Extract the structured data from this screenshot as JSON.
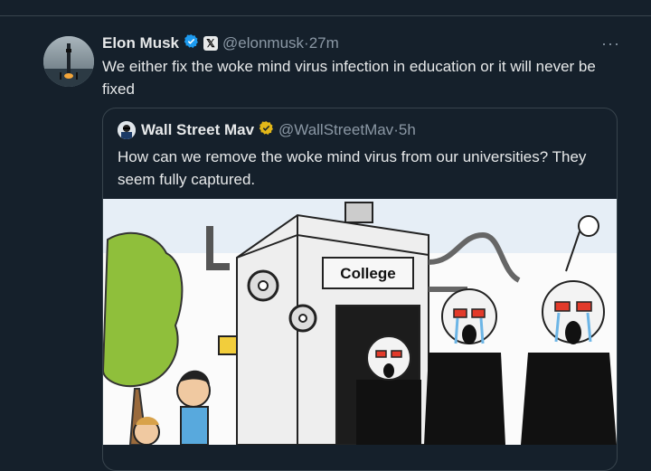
{
  "tweet": {
    "author_name": "Elon Musk",
    "handle": "@elonmusk",
    "separator": "·",
    "time": "27m",
    "text": "We either fix the woke mind virus infection in education or it will never be fixed",
    "more_label": "···",
    "x_badge": "𝕏"
  },
  "quoted": {
    "author_name": "Wall Street Mav",
    "handle": "@WallStreetMav",
    "separator": "·",
    "time": "5h",
    "text": "How can we remove the woke mind virus from our universities? They seem fully captured.",
    "image": {
      "building_label": "College"
    }
  },
  "colors": {
    "background": "#15202b",
    "verified_blue": "#1d9bf0",
    "verified_gold": "#e2b719",
    "secondary_text": "#8b98a5",
    "border": "#38444d"
  }
}
